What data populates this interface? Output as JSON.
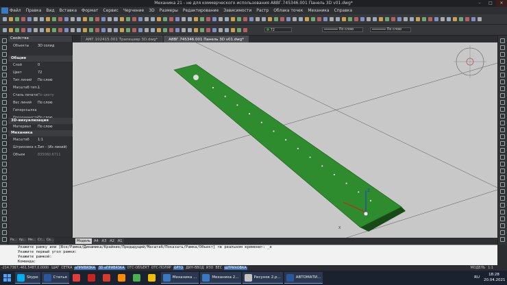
{
  "window": {
    "title": "Механика 21 - не для коммерческого использования A8BГ.745346.001 Панель 3D v01.dwg*",
    "controls": [
      "–",
      "□",
      "×"
    ]
  },
  "menu": [
    "Файл",
    "Правка",
    "Вид",
    "Вставка",
    "Формат",
    "Сервис",
    "Черчение",
    "3D",
    "Размеры",
    "Редактирование",
    "Зависимости",
    "Растр",
    "Облака точек",
    "Механика",
    "Справка"
  ],
  "toolbar": {
    "color_value": "72",
    "linetype_value": "По слою",
    "lineweight_value": "По слою"
  },
  "doc_tabs": [
    {
      "label": "АМГ.102415.001 Трапецевр 3D.dwg*",
      "active": false
    },
    {
      "label": "А8ВГ.745346.001 Панель 3D v01.dwg*",
      "active": true
    }
  ],
  "properties": {
    "title": "Свойства",
    "objects_label": "Объекты",
    "objects_value": "3D солид",
    "sections": {
      "general": "Общие",
      "viz3d": "3D-визуализация",
      "mechanics": "Механика"
    },
    "general_rows": [
      {
        "k": "Слой",
        "v": "0"
      },
      {
        "k": "Цвет",
        "v": "72"
      },
      {
        "k": "Тип линий",
        "v": "По слою"
      },
      {
        "k": "Масштаб тип...",
        "v": "1"
      },
      {
        "k": "Стиль печати",
        "v": "По цвету"
      },
      {
        "k": "Вес линий",
        "v": "По слою"
      },
      {
        "k": "Гиперссылка",
        "v": ""
      },
      {
        "k": "Прозрачность",
        "v": "По слою"
      }
    ],
    "viz_rows": [
      {
        "k": "Материал",
        "v": "По слою"
      }
    ],
    "mech_rows": [
      {
        "k": "Масштаб",
        "v": "1:1"
      },
      {
        "k": "Штриховка к...",
        "v": "Тип - (Из линий)"
      },
      {
        "k": "Объем",
        "v": "835060.6711"
      }
    ],
    "bottom_tabs": [
      "Ра...",
      "Ар...",
      "Ме...",
      "Ст...",
      "Св..."
    ]
  },
  "layout_tabs": [
    "Модель",
    "A4",
    "A3",
    "A2",
    "A1"
  ],
  "command_lines": [
    "Укажите рамку или [Все/Рамка/Динамика/Крайние/Предыдущий/Масштаб/Показать/Рамка/Объект] <в реальном времени>: _e",
    "Укажите первый угол рамки:",
    "Укажите рамкой:",
    "Команда:"
  ],
  "status": {
    "coords": "-214.7367,-461.5487,0.0000",
    "toggles": [
      "ШАГ",
      "СЕТКА",
      "оПРИВЯЗКА",
      "3D оПРИВЯЗКА",
      "ОТС-ОБЪЕКТ",
      "ОТС-ПОЛЯР",
      "ОРТО",
      "ДИН-ВВОД",
      "ИЗО",
      "ВЕС",
      "ШТРИХОВКА"
    ],
    "active": [
      "оПРИВЯЗКА",
      "3D оПРИВЯЗКА",
      "ОРТО",
      "ШТРИХОВКА"
    ],
    "model_label": "МОДЕЛЬ",
    "scale": "1:1"
  },
  "taskbar": {
    "items": [
      {
        "label": "Skype",
        "color": "#00aff0"
      },
      {
        "label": "Статья",
        "color": "#2b579a"
      },
      {
        "label": "",
        "color": "#e43c3c"
      },
      {
        "label": "",
        "color": "#cc2222"
      },
      {
        "label": "",
        "color": "#d73b2c"
      },
      {
        "label": "",
        "color": "#ff8c00"
      },
      {
        "label": "",
        "color": "#4caf50"
      },
      {
        "label": "",
        "color": "#f0c000"
      },
      {
        "label": "Механика ...",
        "color": "#3a78c2"
      },
      {
        "label": "Механика 2...",
        "color": "#3a78c2"
      },
      {
        "label": "Рисунок 2.р...",
        "color": "#c3c3c3"
      },
      {
        "label": "АВТОМАТИ...",
        "color": "#2b579a"
      }
    ],
    "lang": "RU",
    "time": "18:28",
    "date": "20.04.2021"
  },
  "viewcube": {
    "axis_labels": [
      "X",
      "Y",
      "Z"
    ]
  },
  "colors": {
    "part_green": "#2e8b2e",
    "viewport_bg": "#c8c8c8"
  }
}
